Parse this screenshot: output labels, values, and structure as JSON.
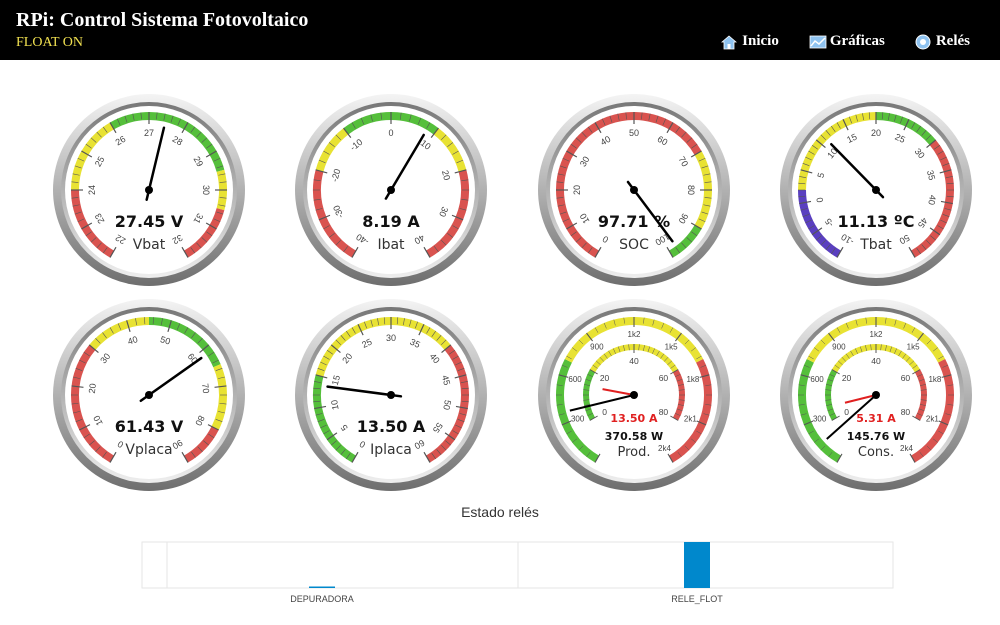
{
  "header": {
    "title": "RPi: Control Sistema Fotovoltaico",
    "status": "FLOAT ON",
    "nav": [
      {
        "label": "Inicio",
        "icon": "home-icon"
      },
      {
        "label": "Gráficas",
        "icon": "chart-icon"
      },
      {
        "label": "Relés",
        "icon": "relay-icon"
      }
    ]
  },
  "gauges": [
    {
      "id": "vbat",
      "name": "Vbat",
      "value_text": "27.45 V",
      "value": 27.45,
      "min": 22,
      "max": 32,
      "ticks": [
        "22",
        "23",
        "24",
        "25",
        "26",
        "27",
        "28",
        "29",
        "30",
        "31",
        "32"
      ],
      "bands": [
        {
          "from": 22,
          "to": 24,
          "color": "#d9534f"
        },
        {
          "from": 24,
          "to": 26,
          "color": "#e8e233"
        },
        {
          "from": 26,
          "to": 29.5,
          "color": "#55bf3b"
        },
        {
          "from": 29.5,
          "to": 30.5,
          "color": "#e8e233"
        },
        {
          "from": 30.5,
          "to": 32,
          "color": "#d9534f"
        }
      ]
    },
    {
      "id": "ibat",
      "name": "Ibat",
      "value_text": "8.19 A",
      "value": 8.19,
      "min": -40,
      "max": 40,
      "ticks": [
        "-40",
        "-30",
        "-20",
        "-10",
        "0",
        "10",
        "20",
        "30",
        "40"
      ],
      "bands": [
        {
          "from": -40,
          "to": -20,
          "color": "#d9534f"
        },
        {
          "from": -20,
          "to": -10,
          "color": "#e8e233"
        },
        {
          "from": -10,
          "to": 10,
          "color": "#55bf3b"
        },
        {
          "from": 10,
          "to": 20,
          "color": "#e8e233"
        },
        {
          "from": 20,
          "to": 40,
          "color": "#d9534f"
        }
      ]
    },
    {
      "id": "soc",
      "name": "SOC",
      "value_text": "97.71 %",
      "value": 97.71,
      "min": 0,
      "max": 100,
      "ticks": [
        "0",
        "10",
        "20",
        "30",
        "40",
        "50",
        "60",
        "70",
        "80",
        "90",
        "100"
      ],
      "bands": [
        {
          "from": 0,
          "to": 70,
          "color": "#d9534f"
        },
        {
          "from": 70,
          "to": 90,
          "color": "#e8e233"
        },
        {
          "from": 90,
          "to": 100,
          "color": "#55bf3b"
        }
      ]
    },
    {
      "id": "tbat",
      "name": "Tbat",
      "value_text": "11.13 ºC",
      "value": 11.13,
      "min": -10,
      "max": 50,
      "ticks": [
        "-10",
        "-5",
        "0",
        "5",
        "10",
        "15",
        "20",
        "25",
        "30",
        "35",
        "40",
        "45",
        "50"
      ],
      "bands": [
        {
          "from": -10,
          "to": 2,
          "color": "#5a3fc0"
        },
        {
          "from": 2,
          "to": 20,
          "color": "#e8e233"
        },
        {
          "from": 20,
          "to": 30,
          "color": "#55bf3b"
        },
        {
          "from": 30,
          "to": 50,
          "color": "#d9534f"
        }
      ]
    },
    {
      "id": "vplaca",
      "name": "Vplaca",
      "value_text": "61.43 V",
      "value": 61.43,
      "min": 0,
      "max": 90,
      "ticks": [
        "0",
        "10",
        "20",
        "30",
        "40",
        "50",
        "60",
        "70",
        "80",
        "90"
      ],
      "bands": [
        {
          "from": 0,
          "to": 30,
          "color": "#d9534f"
        },
        {
          "from": 30,
          "to": 45,
          "color": "#e8e233"
        },
        {
          "from": 45,
          "to": 65,
          "color": "#55bf3b"
        },
        {
          "from": 65,
          "to": 80,
          "color": "#e8e233"
        },
        {
          "from": 80,
          "to": 90,
          "color": "#d9534f"
        }
      ]
    },
    {
      "id": "iplaca",
      "name": "Iplaca",
      "value_text": "13.50 A",
      "value": 13.5,
      "min": 0,
      "max": 60,
      "ticks": [
        "0",
        "5",
        "10",
        "15",
        "20",
        "25",
        "30",
        "35",
        "40",
        "45",
        "50",
        "55",
        "60"
      ],
      "bands": [
        {
          "from": 0,
          "to": 15,
          "color": "#55bf3b"
        },
        {
          "from": 15,
          "to": 40,
          "color": "#e8e233"
        },
        {
          "from": 40,
          "to": 60,
          "color": "#d9534f"
        }
      ]
    },
    {
      "id": "prod",
      "name": "Prod.",
      "value_text": "370.58 W",
      "value": 370.58,
      "min": 0,
      "max": 2400,
      "outer_ticks": [
        "300",
        "600",
        "900",
        "1k2",
        "1k5",
        "1k8",
        "2k1",
        "2k4"
      ],
      "inner_ticks": [
        "0",
        "20",
        "40",
        "60",
        "80"
      ],
      "inner_value_text": "13.50 A",
      "inner_value": 13.5,
      "inner_min": 0,
      "inner_max": 80,
      "bands": [
        {
          "from": 0,
          "to": 700,
          "color": "#55bf3b"
        },
        {
          "from": 700,
          "to": 1700,
          "color": "#e8e233"
        },
        {
          "from": 1700,
          "to": 2400,
          "color": "#d9534f"
        }
      ],
      "inner_bands": [
        {
          "from": 0,
          "to": 20,
          "color": "#55bf3b"
        },
        {
          "from": 20,
          "to": 60,
          "color": "#e8e233"
        },
        {
          "from": 60,
          "to": 80,
          "color": "#d9534f"
        }
      ]
    },
    {
      "id": "cons",
      "name": "Cons.",
      "value_text": "145.76 W",
      "value": 145.76,
      "min": 0,
      "max": 2400,
      "outer_ticks": [
        "300",
        "600",
        "900",
        "1k2",
        "1k5",
        "1k8",
        "2k1",
        "2k4"
      ],
      "inner_ticks": [
        "0",
        "20",
        "40",
        "60",
        "80"
      ],
      "inner_value_text": "5.31 A",
      "inner_value": 5.31,
      "inner_min": 0,
      "inner_max": 80,
      "bands": [
        {
          "from": 0,
          "to": 700,
          "color": "#55bf3b"
        },
        {
          "from": 700,
          "to": 1700,
          "color": "#e8e233"
        },
        {
          "from": 1700,
          "to": 2400,
          "color": "#d9534f"
        }
      ],
      "inner_bands": [
        {
          "from": 0,
          "to": 20,
          "color": "#55bf3b"
        },
        {
          "from": 20,
          "to": 60,
          "color": "#e8e233"
        },
        {
          "from": 60,
          "to": 80,
          "color": "#d9534f"
        }
      ]
    }
  ],
  "relays": {
    "title": "Estado relés",
    "chart_data": {
      "type": "bar",
      "categories": [
        "DEPURADORA",
        "RELE_FLOT"
      ],
      "values": [
        0.5,
        100
      ],
      "ylim": [
        0,
        100
      ],
      "bar_color": "#0088cc"
    }
  }
}
